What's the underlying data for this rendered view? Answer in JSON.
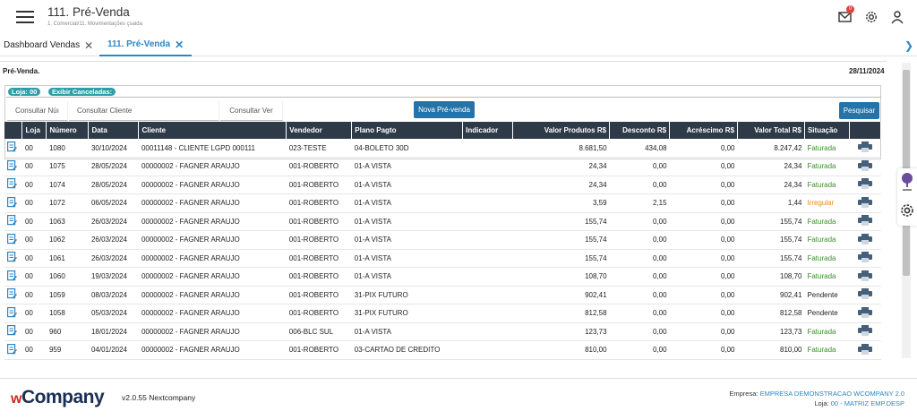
{
  "header": {
    "title": "111. Pré-Venda",
    "breadcrumb": "1. Comercial/11. Movimentações çsaida",
    "notification_count": "0"
  },
  "tabs": [
    {
      "label": "Dashboard Vendas"
    },
    {
      "label": "111. Pré-Venda"
    }
  ],
  "panel": {
    "title": "Pré-Venda.",
    "date": "28/11/2024",
    "chips": {
      "loja": "Loja: 00",
      "canceladas": "Exibir Canceladas:"
    },
    "fields": {
      "numero": "Consultar Núı",
      "cliente": "Consultar Cliente",
      "vendedor": "Consultar Ver"
    },
    "buttons": {
      "nova": "Nova Pré-venda",
      "pesquisar": "Pesquisar"
    }
  },
  "table": {
    "columns": [
      "",
      "Loja",
      "Número",
      "Data",
      "Cliente",
      "Vendedor",
      "Plano Pagto",
      "Indicador",
      "Valor Produtos R$",
      "Desconto R$",
      "Acréscimo R$",
      "Valor Total R$",
      "Situação",
      ""
    ],
    "rows": [
      {
        "loja": "00",
        "numero": "1080",
        "data": "30/10/2024",
        "cliente": "00011148 - CLIENTE LGPD 000111",
        "vendedor": "023-TESTE",
        "plano": "04-BOLETO 30D",
        "indicador": "",
        "produtos": "8.681,50",
        "desconto": "434,08",
        "acrescimo": "0,00",
        "total": "8.247,42",
        "situacao": "Faturada",
        "status": "fat"
      },
      {
        "loja": "00",
        "numero": "1075",
        "data": "28/05/2024",
        "cliente": "00000002 - FAGNER ARAUJO",
        "vendedor": "001-ROBERTO",
        "plano": "01-A VISTA",
        "indicador": "",
        "produtos": "24,34",
        "desconto": "0,00",
        "acrescimo": "0,00",
        "total": "24,34",
        "situacao": "Faturada",
        "status": "fat"
      },
      {
        "loja": "00",
        "numero": "1074",
        "data": "28/05/2024",
        "cliente": "00000002 - FAGNER ARAUJO",
        "vendedor": "001-ROBERTO",
        "plano": "01-A VISTA",
        "indicador": "",
        "produtos": "24,34",
        "desconto": "0,00",
        "acrescimo": "0,00",
        "total": "24,34",
        "situacao": "Faturada",
        "status": "fat"
      },
      {
        "loja": "00",
        "numero": "1072",
        "data": "06/05/2024",
        "cliente": "00000002 - FAGNER ARAUJO",
        "vendedor": "001-ROBERTO",
        "plano": "01-A VISTA",
        "indicador": "",
        "produtos": "3,59",
        "desconto": "2,15",
        "acrescimo": "0,00",
        "total": "1,44",
        "situacao": "Irregular",
        "status": "irr"
      },
      {
        "loja": "00",
        "numero": "1063",
        "data": "26/03/2024",
        "cliente": "00000002 - FAGNER ARAUJO",
        "vendedor": "001-ROBERTO",
        "plano": "01-A VISTA",
        "indicador": "",
        "produtos": "155,74",
        "desconto": "0,00",
        "acrescimo": "0,00",
        "total": "155,74",
        "situacao": "Faturada",
        "status": "fat"
      },
      {
        "loja": "00",
        "numero": "1062",
        "data": "26/03/2024",
        "cliente": "00000002 - FAGNER ARAUJO",
        "vendedor": "001-ROBERTO",
        "plano": "01-A VISTA",
        "indicador": "",
        "produtos": "155,74",
        "desconto": "0,00",
        "acrescimo": "0,00",
        "total": "155,74",
        "situacao": "Faturada",
        "status": "fat"
      },
      {
        "loja": "00",
        "numero": "1061",
        "data": "26/03/2024",
        "cliente": "00000002 - FAGNER ARAUJO",
        "vendedor": "001-ROBERTO",
        "plano": "01-A VISTA",
        "indicador": "",
        "produtos": "155,74",
        "desconto": "0,00",
        "acrescimo": "0,00",
        "total": "155,74",
        "situacao": "Faturada",
        "status": "fat"
      },
      {
        "loja": "00",
        "numero": "1060",
        "data": "19/03/2024",
        "cliente": "00000002 - FAGNER ARAUJO",
        "vendedor": "001-ROBERTO",
        "plano": "01-A VISTA",
        "indicador": "",
        "produtos": "108,70",
        "desconto": "0,00",
        "acrescimo": "0,00",
        "total": "108,70",
        "situacao": "Faturada",
        "status": "fat"
      },
      {
        "loja": "00",
        "numero": "1059",
        "data": "08/03/2024",
        "cliente": "00000002 - FAGNER ARAUJO",
        "vendedor": "001-ROBERTO",
        "plano": "31-PIX FUTURO",
        "indicador": "",
        "produtos": "902,41",
        "desconto": "0,00",
        "acrescimo": "0,00",
        "total": "902,41",
        "situacao": "Pendente",
        "status": "pen"
      },
      {
        "loja": "00",
        "numero": "1058",
        "data": "05/03/2024",
        "cliente": "00000002 - FAGNER ARAUJO",
        "vendedor": "001-ROBERTO",
        "plano": "31-PIX FUTURO",
        "indicador": "",
        "produtos": "812,58",
        "desconto": "0,00",
        "acrescimo": "0,00",
        "total": "812,58",
        "situacao": "Pendente",
        "status": "pen"
      },
      {
        "loja": "00",
        "numero": "960",
        "data": "18/01/2024",
        "cliente": "00000002 - FAGNER ARAUJO",
        "vendedor": "006-BLC SUL",
        "plano": "01-A VISTA",
        "indicador": "",
        "produtos": "123,73",
        "desconto": "0,00",
        "acrescimo": "0,00",
        "total": "123,73",
        "situacao": "Faturada",
        "status": "fat"
      },
      {
        "loja": "00",
        "numero": "959",
        "data": "04/01/2024",
        "cliente": "00000002 - FAGNER ARAUJO",
        "vendedor": "001-ROBERTO",
        "plano": "03-CARTAO DE CREDITO",
        "indicador": "",
        "produtos": "810,00",
        "desconto": "0,00",
        "acrescimo": "0,00",
        "total": "810,00",
        "situacao": "Faturada",
        "status": "fat"
      }
    ]
  },
  "footer": {
    "brand_w": "w",
    "brand_rest": "Company",
    "version": "v2.0.55 Nextcompany",
    "empresa_label": "Empresa:",
    "empresa_value": "EMPRESA DEMONSTRACAO WCOMPANY 2.0",
    "loja_label": "Loja:",
    "loja_value": "00 - MATRIZ EMP.DESP"
  },
  "colors": {
    "accent": "#2d86c4",
    "header_row": "#2f3a48",
    "button": "#2574a9",
    "faturada": "#3c8f2c",
    "irregular": "#e88a16"
  }
}
